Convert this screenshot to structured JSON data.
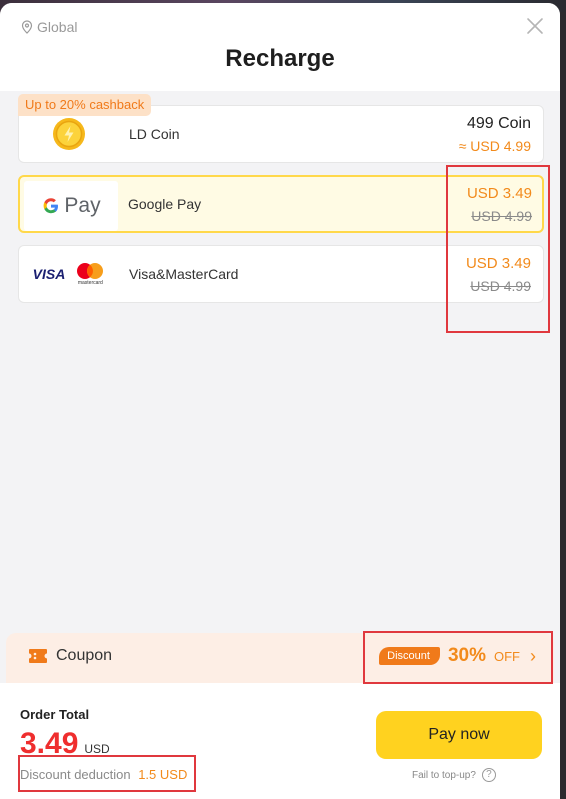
{
  "header": {
    "region": "Global",
    "title": "Recharge"
  },
  "icons": {
    "location": "location-pin-icon",
    "close": "close-icon",
    "coin": "gold-coin-icon",
    "coupon": "ticket-icon",
    "chevron": "chevron-right-icon",
    "help": "question-circle-icon"
  },
  "cashback_badge": "Up to 20% cashback",
  "payment_methods": [
    {
      "name": "LD Coin",
      "amount": "499 Coin",
      "approx": "≈ USD 4.99"
    },
    {
      "name": "Google Pay",
      "logo_text": "Pay",
      "price": "USD 3.49",
      "original_price": "USD 4.99",
      "selected": true
    },
    {
      "name": "Visa&MasterCard",
      "logo_text": "VISA",
      "logo_subtext": "mastercard",
      "price": "USD 3.49",
      "original_price": "USD 4.99"
    }
  ],
  "coupon": {
    "label": "Coupon",
    "tag": "Discount",
    "percent": "30%",
    "off": "OFF",
    "chevron": "›"
  },
  "order": {
    "label": "Order Total",
    "amount": "3.49",
    "currency": "USD",
    "deduction_label": "Discount deduction",
    "deduction_value": "1.5 USD"
  },
  "actions": {
    "pay_label": "Pay now",
    "fail_label": "Fail to top-up?",
    "help_glyph": "?"
  },
  "colors": {
    "accent": "#f28a1b",
    "price_red": "#ef2e2e",
    "pay_button": "#ffd21f",
    "selected_border": "#ffd84a",
    "highlight": "#e0383e"
  }
}
